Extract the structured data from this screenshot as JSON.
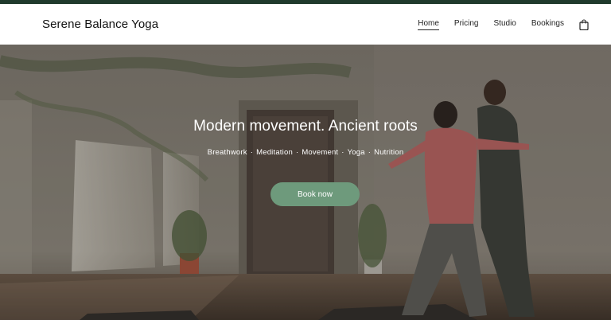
{
  "site": {
    "title": "Serene Balance Yoga"
  },
  "nav": {
    "items": [
      {
        "label": "Home",
        "active": true
      },
      {
        "label": "Pricing",
        "active": false
      },
      {
        "label": "Studio",
        "active": false
      },
      {
        "label": "Bookings",
        "active": false
      }
    ],
    "cart_icon": "shopping-bag-icon"
  },
  "hero": {
    "title": "Modern movement. Ancient roots",
    "tags": [
      "Breathwork",
      "Meditation",
      "Movement",
      "Yoga",
      "Nutrition"
    ],
    "tag_separator": "·",
    "cta_label": "Book now"
  },
  "colors": {
    "topbar": "#1f3a2c",
    "cta": "#6e9a7c",
    "header_bg": "#ffffff"
  }
}
